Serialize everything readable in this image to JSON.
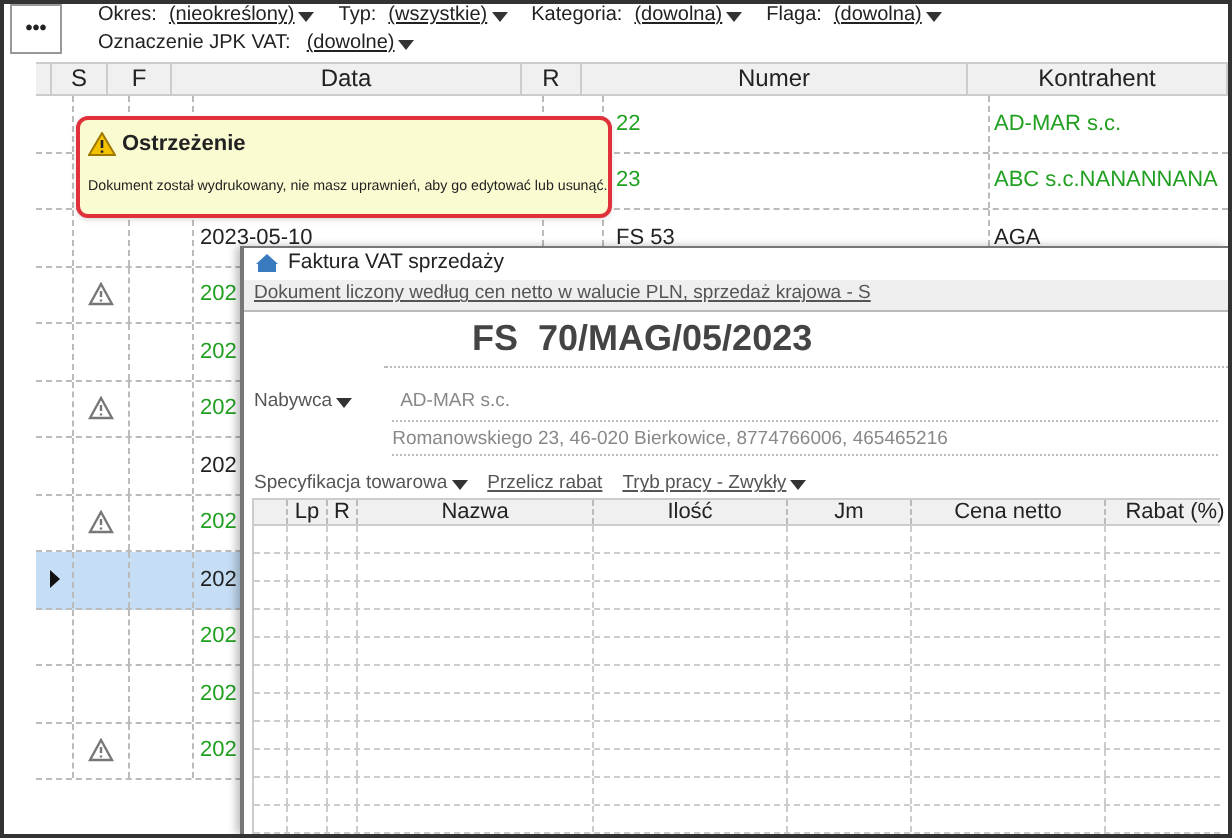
{
  "toolbar": {
    "more_button": "•••",
    "filters": [
      {
        "label": "Okres:",
        "value": "(nieokreślony)"
      },
      {
        "label": "Typ:",
        "value": "(wszystkie)"
      },
      {
        "label": "Kategoria:",
        "value": "(dowolna)"
      },
      {
        "label": "Flaga:",
        "value": "(dowolna)"
      }
    ],
    "jpk_filter": {
      "label": "Oznaczenie JPK VAT:",
      "value": "(dowolne)"
    }
  },
  "table": {
    "columns": [
      "S",
      "F",
      "Data",
      "R",
      "Numer",
      "Kontrahent"
    ],
    "rows": [
      {
        "selected": false,
        "color": "#22a022",
        "data": "",
        "numer": "22",
        "kontrahent": "AD-MAR s.c."
      },
      {
        "selected": false,
        "color": "#22a022",
        "data": "",
        "numer": "23",
        "kontrahent": "ABC s.c.NANANNANA"
      },
      {
        "warning": false,
        "selected": false,
        "color": "#222222",
        "data": "2023-05-10",
        "numer": "FS 53",
        "kontrahent": "AGA"
      },
      {
        "warning": true,
        "selected": false,
        "color": "#22a022",
        "data": "202",
        "numer": "",
        "kontrahent": ""
      },
      {
        "warning": false,
        "selected": false,
        "color": "#22a022",
        "data": "202",
        "numer": "",
        "kontrahent": ""
      },
      {
        "warning": true,
        "selected": false,
        "color": "#22a022",
        "data": "202",
        "numer": "",
        "kontrahent": ""
      },
      {
        "warning": false,
        "selected": false,
        "color": "#222222",
        "data": "202",
        "numer": "",
        "kontrahent": ""
      },
      {
        "warning": true,
        "selected": false,
        "color": "#22a022",
        "data": "202",
        "numer": "",
        "kontrahent": ""
      },
      {
        "warning": false,
        "selected": true,
        "color": "#222222",
        "data": "202",
        "numer": "",
        "kontrahent": ""
      },
      {
        "warning": false,
        "selected": false,
        "color": "#22a022",
        "data": "202",
        "numer": "",
        "kontrahent": ""
      },
      {
        "warning": false,
        "selected": false,
        "color": "#22a022",
        "data": "202",
        "numer": "",
        "kontrahent": ""
      },
      {
        "warning": true,
        "selected": false,
        "color": "#22a022",
        "data": "202",
        "numer": "",
        "kontrahent": ""
      }
    ]
  },
  "tooltip": {
    "title": "Ostrzeżenie",
    "message": "Dokument został wydrukowany, nie masz uprawnień, aby go edytować lub usunąć."
  },
  "dialog": {
    "title": "Faktura VAT sprzedaży",
    "info_link": "Dokument liczony według cen netto w walucie PLN, sprzedaż krajowa - S",
    "doc_type": "FS",
    "doc_number": "70/MAG/05/2023",
    "buyer_label": "Nabywca",
    "buyer_name": "AD-MAR s.c.",
    "buyer_address": "Romanowskiego 23, 46-020 Bierkowice, 8774766006, 465465216",
    "actions": [
      {
        "label": "Specyfikacja towarowa",
        "dropdown": true,
        "underline": false
      },
      {
        "label": "Przelicz rabat",
        "dropdown": false,
        "underline": true
      },
      {
        "label": "Tryb pracy - Zwykły",
        "dropdown": true,
        "underline": true
      }
    ],
    "items_columns": [
      "Lp",
      "R",
      "Nazwa",
      "Ilość",
      "Jm",
      "Cena netto",
      "Rabat (%)"
    ]
  }
}
